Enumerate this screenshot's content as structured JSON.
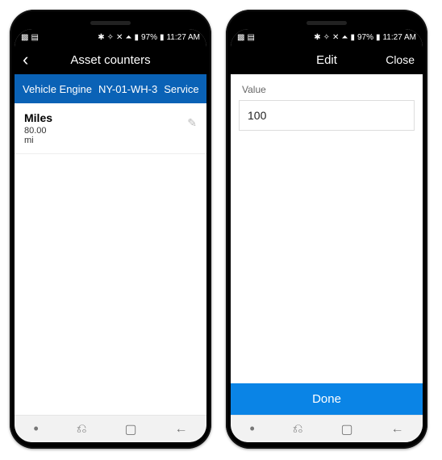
{
  "status": {
    "left_icons": [
      "app1-icon",
      "app2-icon"
    ],
    "right": {
      "bt": "✱",
      "vibrate": "✧",
      "mute": "✕",
      "wifi": "⏶",
      "signal": "▮",
      "battery_pct": "97%",
      "battery_icon": "▮",
      "time": "11:27 AM"
    }
  },
  "left_screen": {
    "app_bar": {
      "back": "‹",
      "title": "Asset counters",
      "right": ""
    },
    "header": {
      "asset_type": "Vehicle Engine",
      "asset_id": "NY-01-WH-3",
      "svc": "Service"
    },
    "counter": {
      "name": "Miles",
      "value": "80.00",
      "unit": "mi",
      "edit_glyph": "✎"
    }
  },
  "right_screen": {
    "app_bar": {
      "left": "",
      "title": "Edit",
      "right": "Close"
    },
    "field": {
      "label": "Value",
      "value": "100"
    },
    "done_label": "Done"
  },
  "nav": {
    "dot": "•",
    "recents": "⎌",
    "home": "▢",
    "back": "←"
  }
}
